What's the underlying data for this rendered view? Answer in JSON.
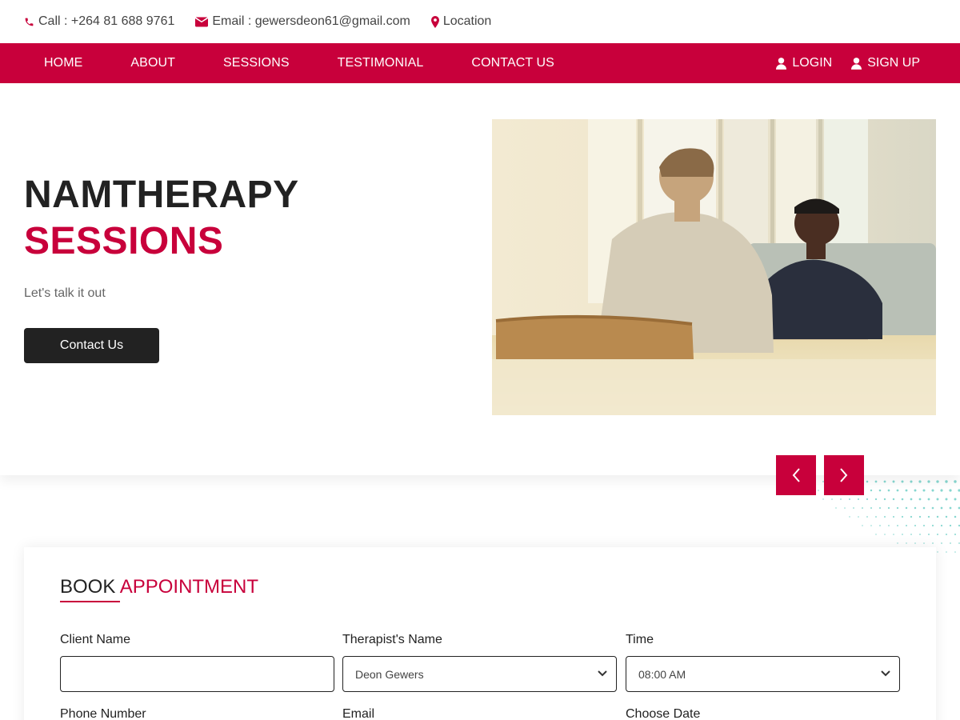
{
  "topbar": {
    "call": "Call : +264 81 688 9761",
    "email": "Email : gewersdeon61@gmail.com",
    "location": "Location"
  },
  "nav": {
    "links": [
      "HOME",
      "ABOUT",
      "SESSIONS",
      "TESTIMONIAL",
      "CONTACT US"
    ],
    "login": "LOGIN",
    "signup": "SIGN UP"
  },
  "hero": {
    "title_line1": "NAMTHERAPY",
    "title_line2": "SESSIONS",
    "subtitle": "Let's talk it out",
    "button": "Contact Us"
  },
  "booking": {
    "title_word1": "BOOK",
    "title_word2": "APPOINTMENT",
    "client_label": "Client Name",
    "client_value": "",
    "therapist_label": "Therapist's Name",
    "therapist_value": "Deon Gewers",
    "time_label": "Time",
    "time_value": "08:00 AM",
    "phone_label": "Phone Number",
    "email_label": "Email",
    "date_label": "Choose Date"
  },
  "colors": {
    "accent": "#c8003b",
    "dark": "#222222",
    "dots": "#5fc9c0"
  },
  "icons": [
    "phone-icon",
    "envelope-icon",
    "map-marker-icon",
    "user-icon",
    "chevron-left-icon",
    "chevron-right-icon",
    "chevron-down-icon"
  ]
}
